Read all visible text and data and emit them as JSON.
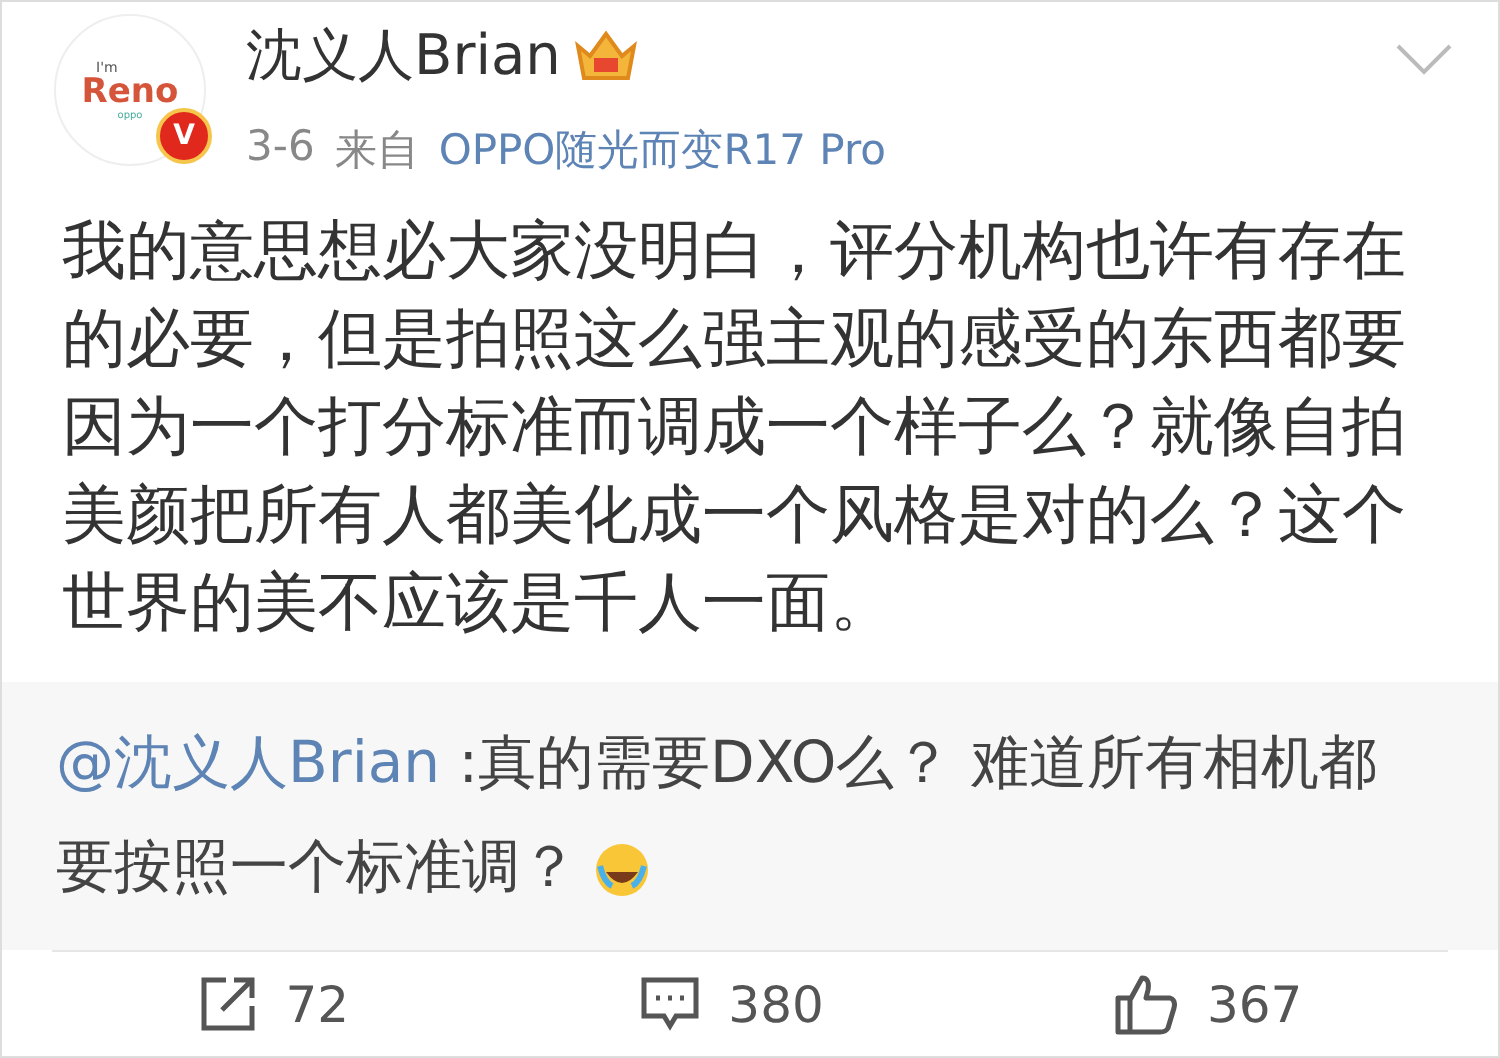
{
  "post": {
    "avatar": {
      "logo_small": "I'm",
      "logo": "Reno",
      "logo_brand": "oppo",
      "verified_mark": "V"
    },
    "author": "沈义人Brian",
    "date": "3-6",
    "source_prefix": "来自",
    "source": "OPPO随光而变R17 Pro",
    "text": "我的意思想必大家没明白，评分机构也许有存在的必要，但是拍照这么强主观的感受的东西都要因为一个打分标准而调成一个样子么？就像自拍美颜把所有人都美化成一个风格是对的么？这个世界的美不应该是千人一面。",
    "repost": {
      "mention": "@沈义人Brian",
      "text": " :真的需要DXO么？ 难道所有相机都要按照一个标准调？"
    },
    "actions": [
      {
        "kind": "repost",
        "count": "72"
      },
      {
        "kind": "comment",
        "count": "380"
      },
      {
        "kind": "like",
        "count": "367"
      }
    ]
  }
}
